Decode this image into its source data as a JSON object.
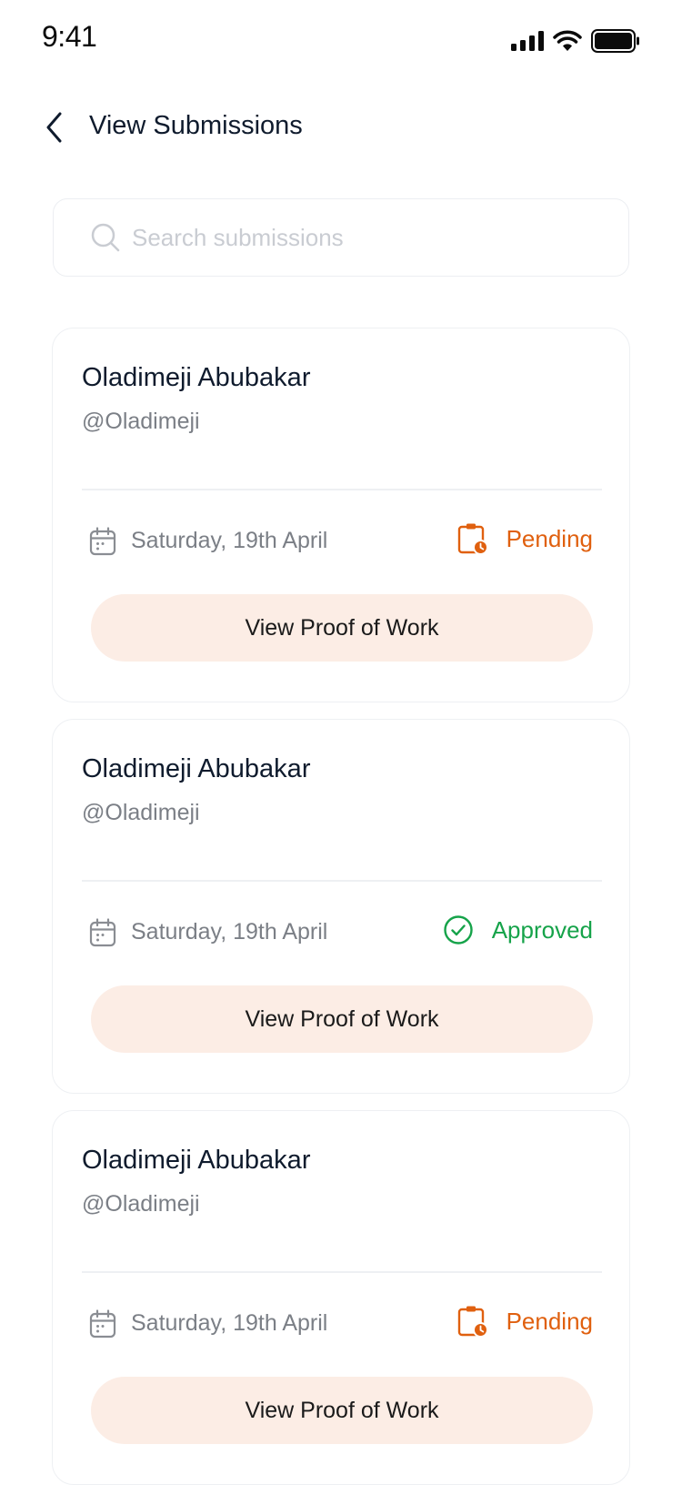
{
  "status_bar": {
    "time": "9:41"
  },
  "header": {
    "title": "View Submissions"
  },
  "search": {
    "placeholder": "Search submissions"
  },
  "submissions": [
    {
      "name": "Oladimeji Abubakar",
      "handle": "@Oladimeji",
      "date": "Saturday, 19th April",
      "status": "Pending",
      "status_type": "pending",
      "button_label": "View Proof of Work"
    },
    {
      "name": "Oladimeji Abubakar",
      "handle": "@Oladimeji",
      "date": "Saturday, 19th April",
      "status": "Approved",
      "status_type": "approved",
      "button_label": "View Proof of Work"
    },
    {
      "name": "Oladimeji Abubakar",
      "handle": "@Oladimeji",
      "date": "Saturday, 19th April",
      "status": "Pending",
      "status_type": "pending",
      "button_label": "View Proof of Work"
    }
  ],
  "colors": {
    "pending": "#e0600f",
    "approved": "#16a34a",
    "button_bg": "#fcede5"
  },
  "icons": {
    "back": "chevron-left-icon",
    "search": "search-icon",
    "date": "calendar-icon",
    "pending": "clipboard-clock-icon",
    "approved": "check-circle-icon"
  }
}
